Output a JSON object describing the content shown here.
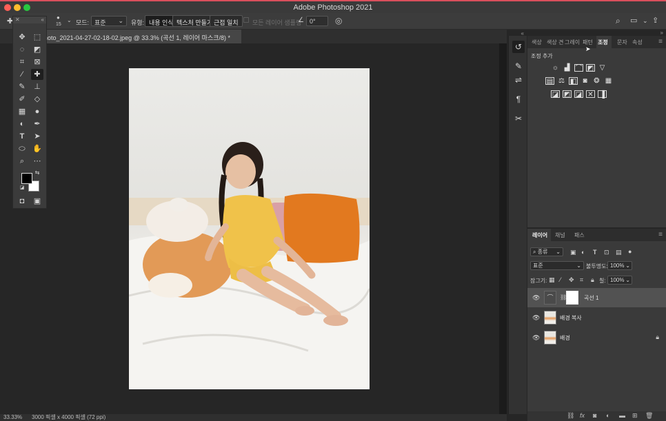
{
  "app": {
    "title": "Adobe Photoshop 2021"
  },
  "options_bar": {
    "brush_size": "15",
    "mode_label": "모드:",
    "mode_value": "표준",
    "type_label": "유형:",
    "type_buttons": [
      "내용 인식",
      "텍스처 만들기",
      "근접 일치"
    ],
    "sample_all_layers": "모든 레이어 샘플링",
    "angle_value": "0°"
  },
  "document": {
    "tab_title": "hoto_2021-04-27-02-18-02.jpeg @ 33.3% (곡선 1, 레이어 마스크/8) *"
  },
  "status": {
    "zoom": "33.33%",
    "doc_info": "3000 픽셀 x 4000 픽셀 (72 ppi)"
  },
  "adjust_panel": {
    "tabs": [
      "색상",
      "색상 견",
      "그레이",
      "패턴",
      "조정",
      "문자",
      "속성"
    ],
    "active_tab": "조정",
    "title": "조정 추가"
  },
  "layers_panel": {
    "tabs": [
      "레이어",
      "채널",
      "패스"
    ],
    "filter_value": "종류",
    "blend_mode": "표준",
    "opacity_label": "불투명도:",
    "opacity_value": "100%",
    "lock_label": "잠그기:",
    "fill_label": "칠:",
    "fill_value": "100%",
    "layers": [
      {
        "name": "곡선 1",
        "selected": true
      },
      {
        "name": "배경 복사",
        "selected": false
      },
      {
        "name": "배경",
        "selected": false,
        "locked": true
      }
    ]
  },
  "colors": {
    "foreground": "#000000",
    "background": "#ffffff"
  }
}
